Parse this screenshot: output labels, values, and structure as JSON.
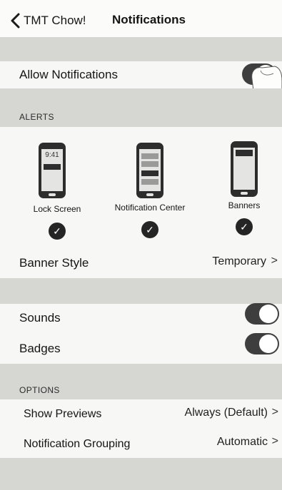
{
  "nav": {
    "back_label": "TMT Chow!",
    "title": "Notifications"
  },
  "allow": {
    "label": "Allow Notifications",
    "on": true
  },
  "alerts": {
    "header": "ALERTS",
    "items": [
      {
        "label": "Lock Screen",
        "time": "9:41",
        "checked": true
      },
      {
        "label": "Notification Center",
        "checked": true
      },
      {
        "label": "Banners",
        "checked": true
      }
    ]
  },
  "banner_style": {
    "label": "Banner Style",
    "value": "Temporary"
  },
  "sounds": {
    "label": "Sounds",
    "on": true
  },
  "badges": {
    "label": "Badges",
    "on": true
  },
  "options": {
    "header": "OPTIONS",
    "show_previews": {
      "label": "Show Previews",
      "value": "Always (Default)"
    },
    "grouping": {
      "label": "Notification Grouping",
      "value": "Automatic"
    }
  },
  "icons": {
    "back": "chevron-left-icon",
    "disclosure": "chevron-right-icon",
    "check": "checkmark-icon"
  },
  "colors": {
    "toggle_on": "#3e3e3e",
    "separator": "#d6d6d2",
    "background": "#f6f6f4"
  }
}
